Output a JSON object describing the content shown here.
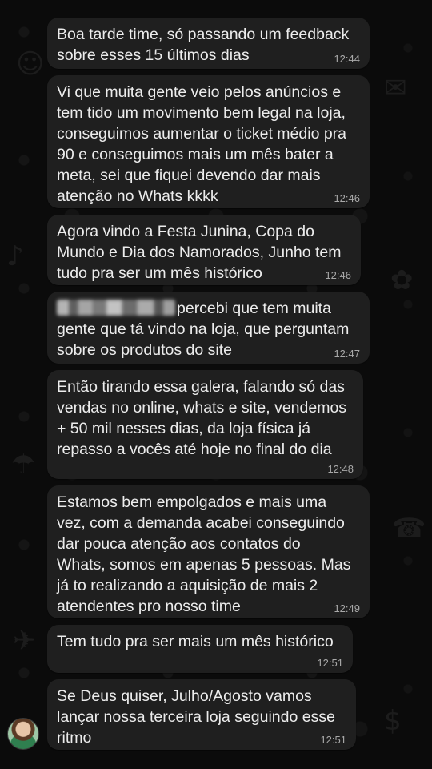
{
  "messages": [
    {
      "text": "Boa tarde time, só passando um feedback\nsobre esses 15 últimos dias",
      "time": "12:44"
    },
    {
      "text": "Vi que muita gente veio pelos anúncios e\ntem tido um movimento bem legal na loja,\nconseguimos aumentar o ticket médio pra\n90 e conseguimos mais um mês bater a\nmeta, sei que fiquei devendo dar mais\natenção no Whats kkkk",
      "time": "12:46"
    },
    {
      "text": "Agora vindo a Festa Junina, Copa do\nMundo e Dia dos Namorados, Junho tem\ntudo pra ser um mês histórico",
      "time": "12:46"
    },
    {
      "text": "percebi que tem muita\ngente que tá vindo na loja, que perguntam\nsobre os produtos do site",
      "time": "12:47",
      "redacted_prefix": true
    },
    {
      "text": "Então tirando essa galera, falando só das\nvendas no online, whats e site, vendemos\n+ 50 mil nesses dias, da loja física já\nrepasso a vocês até hoje no final do dia",
      "time": "12:48"
    },
    {
      "text": "Estamos bem empolgados e mais uma\nvez, com a demanda acabei conseguindo\ndar pouca atenção aos contatos do\nWhats, somos em apenas 5 pessoas. Mas\njá to realizando a aquisição de mais 2\natendentes pro nosso time",
      "time": "12:49"
    },
    {
      "text": "Tem tudo pra ser mais um mês histórico",
      "time": "12:51"
    },
    {
      "text": "Se Deus quiser, Julho/Agosto vamos\nlançar nossa terceira loja seguindo esse\nritmo",
      "time": "12:51"
    }
  ],
  "colors": {
    "background": "#0b0b0b",
    "bubble": "#1f1f1f",
    "text": "#ececec",
    "timestamp": "#a8a8a8"
  },
  "icons": [
    "sender-avatar"
  ]
}
